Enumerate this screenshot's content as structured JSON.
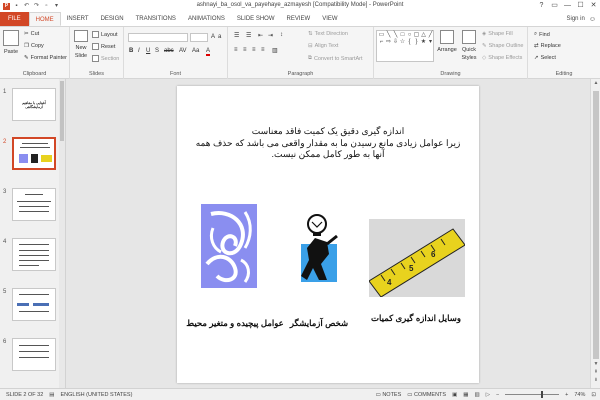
{
  "window": {
    "title": "ashnayi_ba_osol_va_payehaye_azmayesh [Compatibility Mode] - PowerPoint",
    "ctrl_help": "?",
    "ctrl_restore": "▭",
    "ctrl_min": "—",
    "ctrl_max": "☐",
    "ctrl_close": "✕",
    "app_icon": "P"
  },
  "tabs": [
    "FILE",
    "HOME",
    "INSERT",
    "DESIGN",
    "TRANSITIONS",
    "ANIMATIONS",
    "SLIDE SHOW",
    "REVIEW",
    "VIEW"
  ],
  "account": {
    "signin": "Sign in"
  },
  "ribbon": {
    "clipboard": {
      "label": "Clipboard",
      "paste": "Paste",
      "cut": "Cut",
      "copy": "Copy",
      "format_painter": "Format Painter"
    },
    "slides": {
      "label": "Slides",
      "new_slide": "New",
      "new_slide2": "Slide",
      "layout": "Layout",
      "reset": "Reset",
      "section": "Section"
    },
    "font": {
      "label": "Font",
      "bold": "B",
      "italic": "I",
      "underline": "U",
      "strike": "S",
      "shadow": "abc",
      "spacing": "AV",
      "case": "Aa",
      "color": "A"
    },
    "paragraph": {
      "label": "Paragraph",
      "text_direction": "Text Direction",
      "align_text": "Align Text",
      "smartart": "Convert to SmartArt"
    },
    "drawing": {
      "label": "Drawing",
      "arrange": "Arrange",
      "quick_styles": "Quick",
      "quick_styles2": "Styles",
      "shape_fill": "Shape Fill",
      "shape_outline": "Shape Outline",
      "shape_effects": "Shape Effects"
    },
    "editing": {
      "label": "Editing",
      "find": "Find",
      "replace": "Replace",
      "select": "Select"
    }
  },
  "thumbnails": {
    "numbers": [
      "1",
      "2",
      "3",
      "4",
      "5",
      "6"
    ],
    "slide1_title": "آشنایی با مفاهیم آزمایشگاهی"
  },
  "slide": {
    "title": "اندازه گیری دقیق یک کمیت فاقد معناست",
    "body": "زیرا عوامل زیادی مانع رسیدن ما به مقدار واقعی می باشد که حذف همه آنها به طور کامل ممکن نیست.",
    "captions": [
      "عوامل پیچیده و متغیر محیط",
      "شخص آزمایشگر",
      "وسایل اندازه گیری کمیات"
    ]
  },
  "status": {
    "slide_of": "SLIDE 2 OF 32",
    "language": "ENGLISH (UNITED STATES)",
    "notes": "NOTES",
    "comments": "COMMENTS",
    "zoom": "74%"
  },
  "colors": {
    "accent": "#d24726",
    "swirl": "#8a8ef0",
    "tape": "#e8d21e"
  }
}
